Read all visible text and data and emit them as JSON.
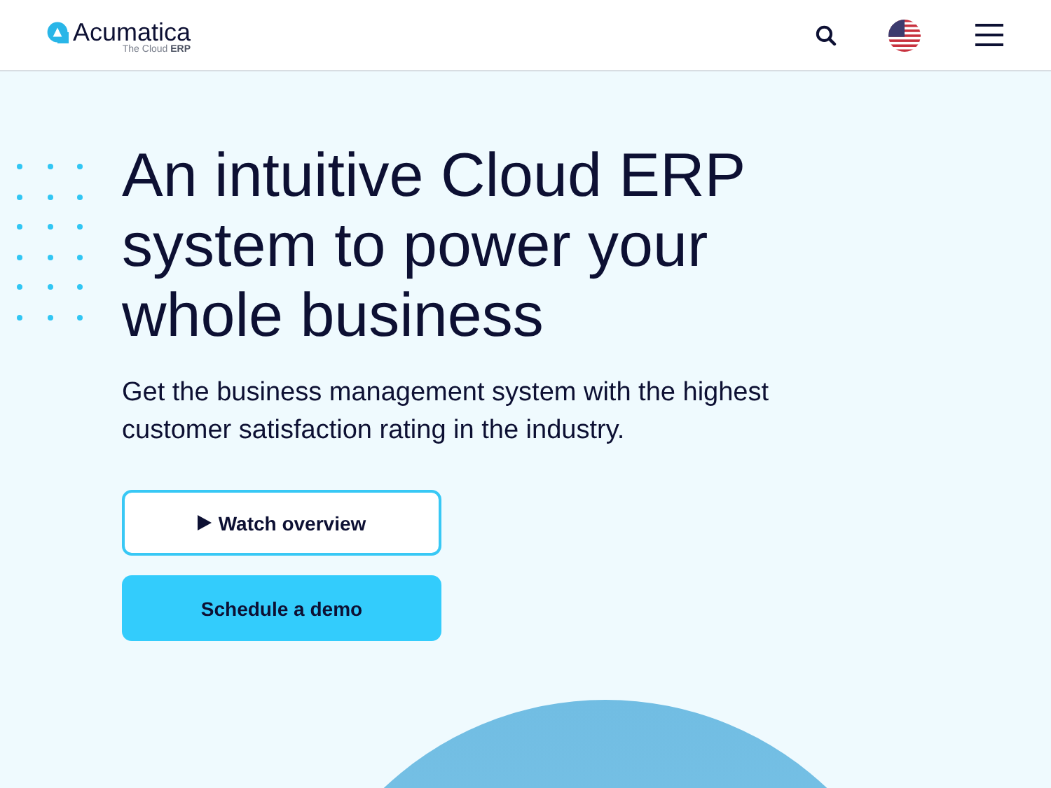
{
  "header": {
    "logo_name": "Acumatica",
    "logo_tagline_prefix": "The Cloud",
    "logo_tagline_bold": "ERP"
  },
  "hero": {
    "headline": "An intuitive Cloud ERP system to power your whole business",
    "subheading": "Get the business management system with the highest customer satisfaction rating in the industry.",
    "buttons": [
      {
        "label": "Watch overview",
        "kind": "outline"
      },
      {
        "label": "Schedule a demo",
        "kind": "filled"
      }
    ]
  }
}
